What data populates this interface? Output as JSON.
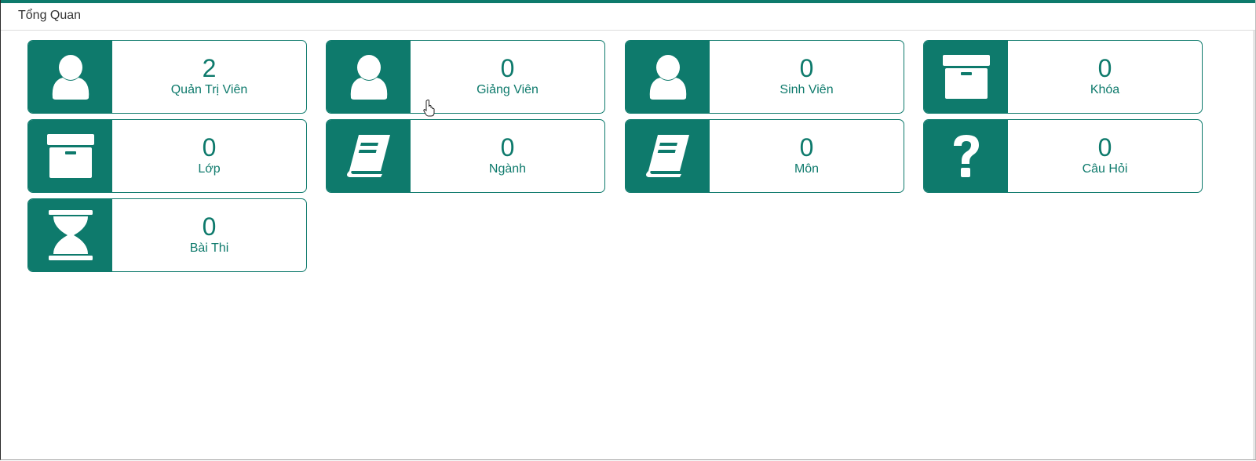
{
  "header": {
    "title": "Tổng Quan"
  },
  "colors": {
    "accent": "#0e7a6c"
  },
  "cards": [
    {
      "icon": "user-icon",
      "count": "2",
      "label": "Quản Trị Viên"
    },
    {
      "icon": "user-icon",
      "count": "0",
      "label": "Giảng Viên"
    },
    {
      "icon": "user-icon",
      "count": "0",
      "label": "Sinh Viên"
    },
    {
      "icon": "archive-box-icon",
      "count": "0",
      "label": "Khóa"
    },
    {
      "icon": "archive-box-icon",
      "count": "0",
      "label": "Lớp"
    },
    {
      "icon": "book-icon",
      "count": "0",
      "label": "Ngành"
    },
    {
      "icon": "book-icon",
      "count": "0",
      "label": "Môn"
    },
    {
      "icon": "question-icon",
      "count": "0",
      "label": "Câu Hỏi"
    },
    {
      "icon": "hourglass-icon",
      "count": "0",
      "label": "Bài Thi"
    }
  ]
}
